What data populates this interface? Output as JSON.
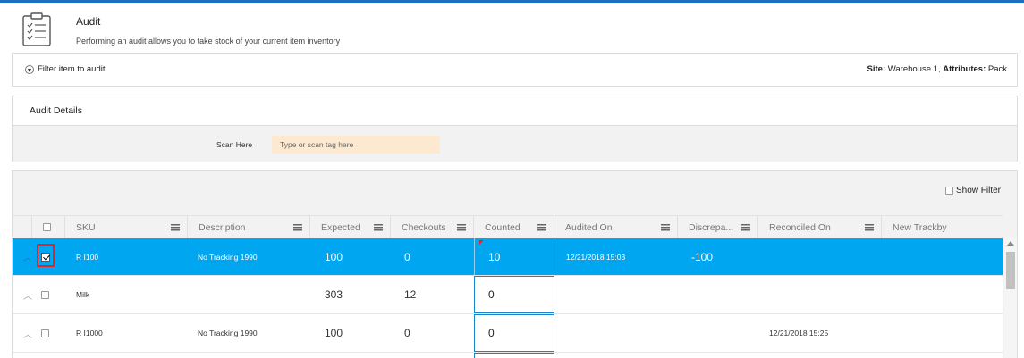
{
  "header": {
    "title": "Audit",
    "subtitle": "Performing an audit allows you to take stock of your current item inventory",
    "icon": "clipboard-checklist-icon"
  },
  "filter": {
    "toggle_label": "Filter item to audit",
    "site_key": "Site:",
    "site_value": "Warehouse 1,",
    "attributes_key": "Attributes:",
    "attributes_value": "Pack"
  },
  "details": {
    "title": "Audit Details",
    "scan_label": "Scan Here",
    "scan_placeholder": "Type or scan tag here",
    "scan_value": ""
  },
  "grid": {
    "show_filter_label": "Show Filter",
    "columns": [
      {
        "label": "SKU"
      },
      {
        "label": "Description"
      },
      {
        "label": "Expected"
      },
      {
        "label": "Checkouts"
      },
      {
        "label": "Counted"
      },
      {
        "label": "Audited On"
      },
      {
        "label": "Discrepa..."
      },
      {
        "label": "Reconciled On"
      },
      {
        "label": "New Trackby"
      }
    ],
    "rows": [
      {
        "sku": "R I100",
        "description": "No Tracking 1990",
        "expected": "100",
        "checkouts": "0",
        "counted": "10",
        "audited_on": "12/21/2018 15:03",
        "discrepancy": "-100",
        "reconciled_on": "",
        "new_trackby": "",
        "selected": true,
        "checked": true
      },
      {
        "sku": "Milk",
        "description": "",
        "expected": "303",
        "checkouts": "12",
        "counted": "0",
        "audited_on": "",
        "discrepancy": "",
        "reconciled_on": "",
        "new_trackby": "",
        "selected": false,
        "checked": false
      },
      {
        "sku": "R I1000",
        "description": "No Tracking 1990",
        "expected": "100",
        "checkouts": "0",
        "counted": "0",
        "audited_on": "",
        "discrepancy": "",
        "reconciled_on": "12/21/2018 15:25",
        "new_trackby": "",
        "selected": false,
        "checked": false
      }
    ]
  },
  "colors": {
    "accent": "#1a6fc0",
    "selected_row": "#00a6f0",
    "scan_input_bg": "#fde9cf",
    "highlight_outline": "#e1262b"
  }
}
